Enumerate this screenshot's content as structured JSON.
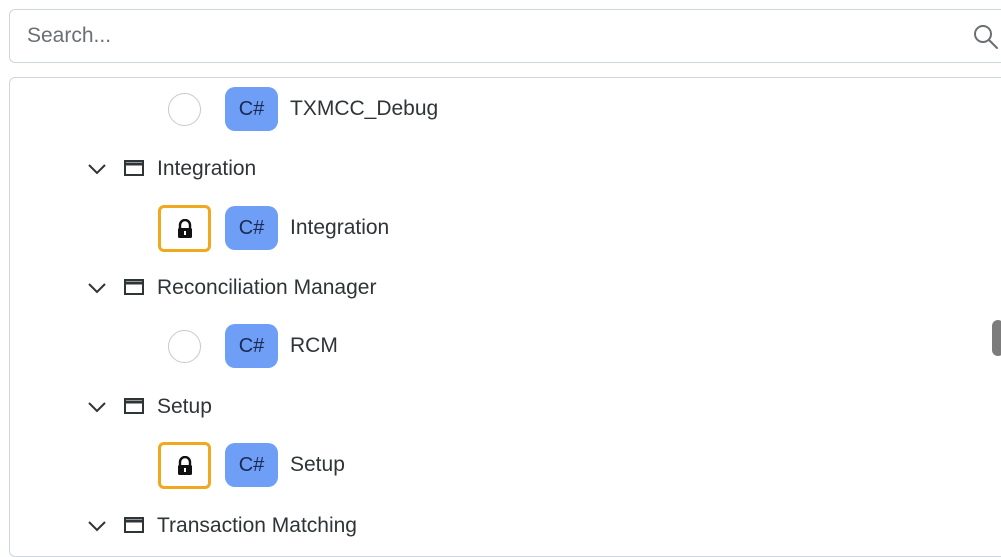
{
  "search": {
    "placeholder": "Search...",
    "value": ""
  },
  "tree": {
    "items": [
      {
        "kind": "item",
        "status": "radio",
        "language": "C#",
        "label": "TXMCC_Debug"
      },
      {
        "kind": "group",
        "label": "Integration",
        "expanded": true
      },
      {
        "kind": "item",
        "status": "locked",
        "language": "C#",
        "label": "Integration"
      },
      {
        "kind": "group",
        "label": "Reconciliation Manager",
        "expanded": true
      },
      {
        "kind": "item",
        "status": "radio",
        "language": "C#",
        "label": "RCM"
      },
      {
        "kind": "group",
        "label": "Setup",
        "expanded": true
      },
      {
        "kind": "item",
        "status": "locked",
        "language": "C#",
        "label": "Setup"
      },
      {
        "kind": "group",
        "label": "Transaction Matching",
        "expanded": true
      }
    ]
  },
  "colors": {
    "lock_border": "#f0a81f",
    "language_badge": "#6e9ef5",
    "border": "#cfd6de"
  },
  "icons": {
    "search": "search-icon",
    "expand": "chevron-down-icon",
    "group": "window-icon",
    "lock": "lock-icon",
    "status": "radio-icon"
  }
}
